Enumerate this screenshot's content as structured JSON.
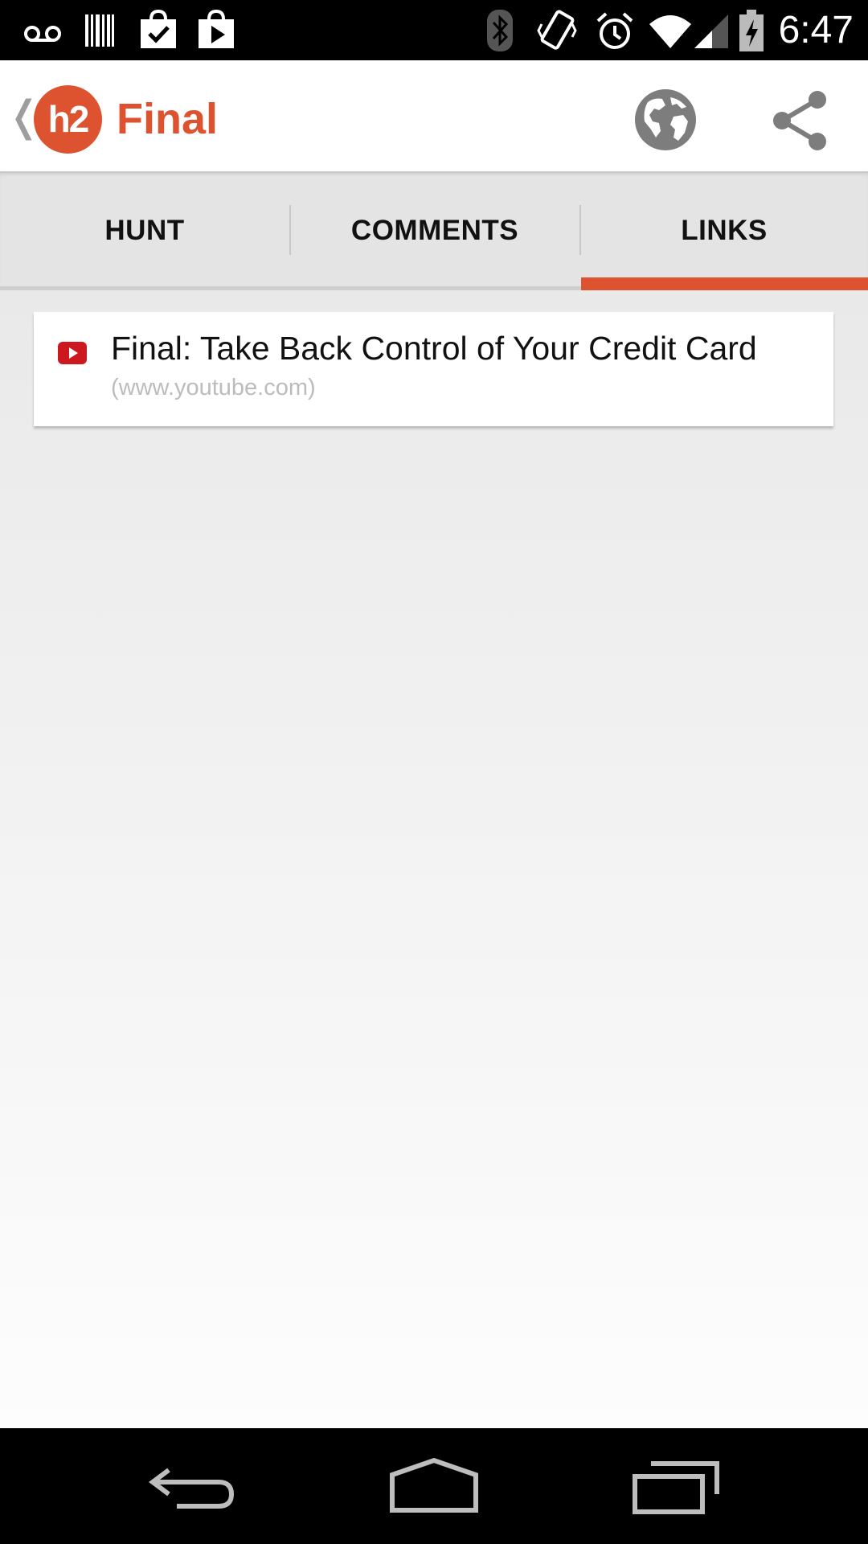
{
  "status_bar": {
    "time": "6:47",
    "icons": [
      "voicemail-icon",
      "barcode-icon",
      "bag-check-icon",
      "play-store-icon",
      "bluetooth-icon",
      "vibrate-icon",
      "alarm-icon",
      "wifi-icon",
      "signal-icon",
      "battery-charging-icon"
    ]
  },
  "app_bar": {
    "logo_text": "h2",
    "title": "Final",
    "back_icon": "chevron-left-icon",
    "actions": [
      "globe-icon",
      "share-icon"
    ]
  },
  "tabs": [
    {
      "label": "HUNT",
      "selected": false
    },
    {
      "label": "COMMENTS",
      "selected": false
    },
    {
      "label": "LINKS",
      "selected": true
    }
  ],
  "links": [
    {
      "icon": "youtube-icon",
      "title": "Final: Take Back Control of Your Credit Card",
      "domain": "(www.youtube.com)"
    }
  ],
  "nav_bar": {
    "buttons": [
      "back-icon",
      "home-icon",
      "recents-icon"
    ]
  },
  "colors": {
    "accent": "#dd5330",
    "status_bar": "#000000",
    "tab_bar": "#e4e4e4",
    "youtube_red": "#cc181e"
  }
}
